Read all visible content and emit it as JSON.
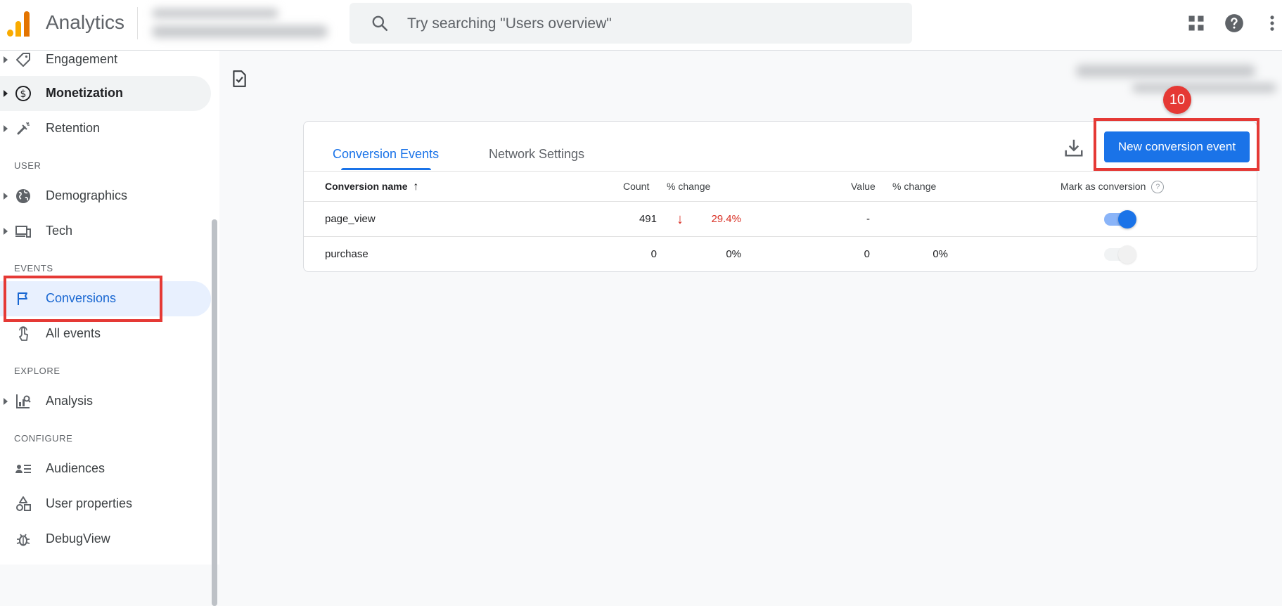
{
  "header": {
    "app_title": "Analytics",
    "search_placeholder": "Try searching \"Users overview\""
  },
  "sidebar": {
    "reports_items": [
      {
        "label": "Engagement",
        "icon": "tag-icon"
      },
      {
        "label": "Monetization",
        "icon": "dollar-icon"
      },
      {
        "label": "Retention",
        "icon": "magnet-icon"
      }
    ],
    "section_user": "USER",
    "user_items": [
      {
        "label": "Demographics",
        "icon": "globe-icon"
      },
      {
        "label": "Tech",
        "icon": "devices-icon"
      }
    ],
    "section_events": "EVENTS",
    "events_items": [
      {
        "label": "Conversions",
        "icon": "flag-icon"
      },
      {
        "label": "All events",
        "icon": "touch-icon"
      }
    ],
    "section_explore": "EXPLORE",
    "explore_items": [
      {
        "label": "Analysis",
        "icon": "analysis-icon"
      }
    ],
    "section_configure": "CONFIGURE",
    "configure_items": [
      {
        "label": "Audiences",
        "icon": "audience-icon"
      },
      {
        "label": "User properties",
        "icon": "shapes-icon"
      },
      {
        "label": "DebugView",
        "icon": "bug-icon"
      }
    ]
  },
  "main": {
    "tabs": [
      {
        "label": "Conversion Events",
        "active": true
      },
      {
        "label": "Network Settings",
        "active": false
      }
    ],
    "new_button_label": "New conversion event",
    "step_badge": "10",
    "table": {
      "headers": {
        "name": "Conversion name",
        "count": "Count",
        "count_change": "% change",
        "value": "Value",
        "value_change": "% change",
        "mark": "Mark as conversion"
      },
      "sort_arrow": "↑",
      "help_glyph": "?",
      "rows": [
        {
          "name": "page_view",
          "count": "491",
          "count_change": "29.4%",
          "trend_glyph": "↓",
          "value": "-",
          "value_change": "",
          "is_conversion": true
        },
        {
          "name": "purchase",
          "count": "0",
          "count_change": "0%",
          "value": "0",
          "value_change": "0%",
          "is_conversion": false
        }
      ]
    }
  },
  "colors": {
    "accent": "#1a73e8",
    "highlight_red": "#e53935",
    "negative_red": "#d93025"
  }
}
